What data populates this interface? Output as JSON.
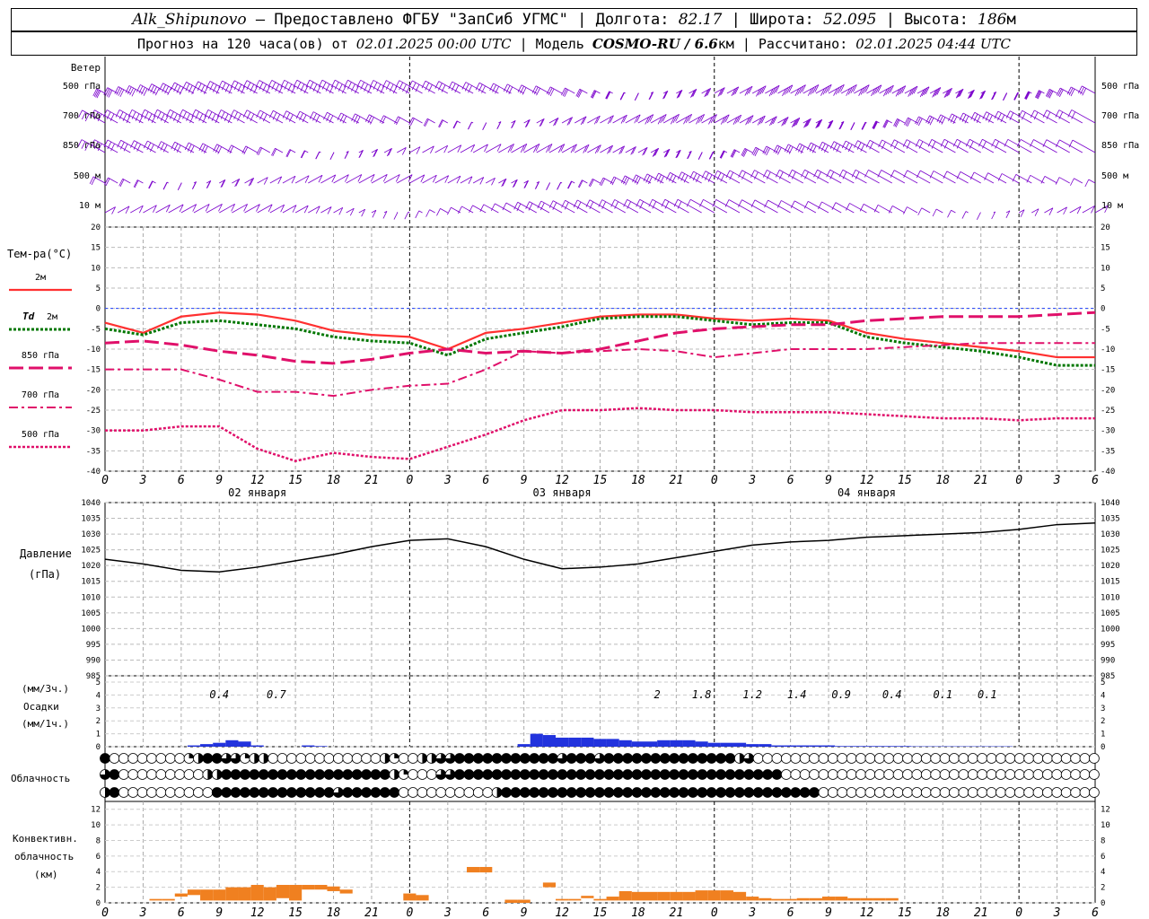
{
  "header": {
    "station": "Alk_Shipunovo",
    "provider": " – Предоставлено ФГБУ \"ЗапСиб УГМС\" | ",
    "lon_label": "Долгота: ",
    "lon": "82.17",
    "lat_label": " | Широта: ",
    "lat": "52.095",
    "alt_label": " | Высота: ",
    "alt": "186",
    "alt_unit": "м"
  },
  "subheader": {
    "forecast_label": "Прогноз на 120 часа(ов) от ",
    "start": "02.01.2025 00:00 UTC",
    "model_label": " | Модель ",
    "model": "COSMO-RU / 6.6",
    "model_unit": "км",
    "calc_label": " | Рассчитано: ",
    "calc": "02.01.2025 04:44 UTC"
  },
  "colors": {
    "t2m": "#ff3030",
    "td2m": "#007700",
    "p850": "#e0106a",
    "p700": "#e0106a",
    "p500": "#e0106a",
    "wind": "#7a00cc",
    "precip": "#2233dd",
    "conv": "#f08020",
    "zero_line": "#2040ff"
  },
  "hour_ticks": [
    "0",
    "3",
    "6",
    "9",
    "12",
    "15",
    "18",
    "21",
    "0",
    "3",
    "6",
    "9",
    "12",
    "15",
    "18",
    "21",
    "0",
    "3",
    "6",
    "9",
    "12",
    "15",
    "18",
    "21",
    "0",
    "3",
    "6"
  ],
  "day_labels": [
    "02 января",
    "03 января",
    "04 января"
  ],
  "wind_panel": {
    "title": "Ветер",
    "levels": [
      "500 гПа",
      "700 гПа",
      "850 гПа",
      "500 м",
      "10 м"
    ],
    "levels_right": [
      "500 гПа",
      "700 гПа",
      "850 гПа",
      "500 м",
      "10 м"
    ]
  },
  "temp_panel": {
    "title": "Тем-ра(°С)",
    "legend": [
      {
        "key": "t2m",
        "label": "2м",
        "style": "solid"
      },
      {
        "key": "td2m",
        "label": "2м",
        "prefix": "Td",
        "style": "dotted"
      },
      {
        "key": "p850",
        "label": "850 гПа",
        "style": "dash"
      },
      {
        "key": "p700",
        "label": "700 гПа",
        "style": "dashdot"
      },
      {
        "key": "p500",
        "label": "500 гПа",
        "style": "dot"
      }
    ],
    "yticks": [
      "20",
      "15",
      "10",
      "5",
      "0",
      "-5",
      "-10",
      "-15",
      "-20",
      "-25",
      "-30",
      "-35",
      "-40"
    ]
  },
  "pressure_panel": {
    "title1": "Давление",
    "title2": "(гПа)",
    "yticks": [
      "1040",
      "1035",
      "1030",
      "1025",
      "1020",
      "1015",
      "1010",
      "1005",
      "1000",
      "995",
      "990",
      "985"
    ]
  },
  "precip_panel": {
    "title1": "(мм/3ч.)",
    "title2": "Осадки",
    "title3": "(мм/1ч.)",
    "yticks": [
      "5",
      "4",
      "3",
      "2",
      "1",
      "0"
    ],
    "sums": [
      {
        "h": 9,
        "v": "0.4"
      },
      {
        "h": 13.5,
        "v": "0.7"
      },
      {
        "h": 43.5,
        "v": "2"
      },
      {
        "h": 47,
        "v": "1.8"
      },
      {
        "h": 51,
        "v": "1.2"
      },
      {
        "h": 54.5,
        "v": "1.4"
      },
      {
        "h": 58,
        "v": "0.9"
      },
      {
        "h": 62,
        "v": "0.4"
      },
      {
        "h": 66,
        "v": "0.1"
      },
      {
        "h": 69.5,
        "v": "0.1"
      }
    ]
  },
  "cloud_panel": {
    "title": "Облачность"
  },
  "conv_panel": {
    "title1": "Конвективн.",
    "title2": "облачность",
    "title3": "(км)",
    "yticks": [
      "12",
      "10",
      "8",
      "6",
      "4",
      "2",
      "0"
    ]
  },
  "chart_data": [
    {
      "type": "line",
      "name": "temperature",
      "x_hours": [
        0,
        3,
        6,
        9,
        12,
        15,
        18,
        21,
        24,
        27,
        30,
        33,
        36,
        39,
        42,
        45,
        48,
        51,
        54,
        57,
        60,
        63,
        66,
        69,
        72,
        75,
        78
      ],
      "ylim": [
        -40,
        20
      ],
      "series": [
        {
          "key": "t2m",
          "values": [
            -3.5,
            -6,
            -2,
            -1,
            -1.5,
            -3,
            -5.5,
            -6.5,
            -7,
            -10,
            -6,
            -5,
            -3.5,
            -2,
            -1.5,
            -1.5,
            -2.5,
            -3,
            -2.5,
            -3,
            -6,
            -7.5,
            -8.5,
            -9.5,
            -10.5,
            -12,
            -12
          ]
        },
        {
          "key": "td2m",
          "values": [
            -5,
            -6.5,
            -3.5,
            -3,
            -4,
            -5,
            -7,
            -8,
            -8.5,
            -11.5,
            -7.5,
            -6,
            -4.5,
            -2.5,
            -2,
            -2,
            -3,
            -4,
            -3.5,
            -3.5,
            -7,
            -8.5,
            -9.5,
            -10.5,
            -12,
            -14,
            -14
          ]
        },
        {
          "key": "p850",
          "values": [
            -8.5,
            -8,
            -9,
            -10.5,
            -11.5,
            -13,
            -13.5,
            -12.5,
            -11,
            -10,
            -11,
            -10.5,
            -11,
            -10,
            -8,
            -6,
            -5,
            -4.5,
            -4,
            -4,
            -3,
            -2.5,
            -2,
            -2,
            -2,
            -1.5,
            -1
          ]
        },
        {
          "key": "p700",
          "values": [
            -15,
            -15,
            -15,
            -17.5,
            -20.5,
            -20.5,
            -21.5,
            -20,
            -19,
            -18.5,
            -15,
            -10.5,
            -11,
            -10.5,
            -10,
            -10.5,
            -12,
            -11,
            -10,
            -10,
            -10,
            -9.5,
            -9,
            -8.5,
            -8.5,
            -8.5,
            -8.5
          ]
        },
        {
          "key": "p500",
          "values": [
            -30,
            -30,
            -29,
            -29,
            -34.5,
            -37.5,
            -35.5,
            -36.5,
            -37,
            -34,
            -31,
            -27.5,
            -25,
            -25,
            -24.5,
            -25,
            -25,
            -25.5,
            -25.5,
            -25.5,
            -26,
            -26.5,
            -27,
            -27,
            -27.5,
            -27,
            -27
          ]
        }
      ]
    },
    {
      "type": "line",
      "name": "pressure",
      "x_hours": [
        0,
        3,
        6,
        9,
        12,
        15,
        18,
        21,
        24,
        27,
        30,
        33,
        36,
        39,
        42,
        45,
        48,
        51,
        54,
        57,
        60,
        63,
        66,
        69,
        72,
        75,
        78
      ],
      "ylim": [
        985,
        1040
      ],
      "values": [
        1022,
        1020.5,
        1018.5,
        1018,
        1019.5,
        1021.5,
        1023.5,
        1026,
        1028,
        1028.5,
        1026,
        1022,
        1019,
        1019.5,
        1020.5,
        1022.5,
        1024.5,
        1026.5,
        1027.5,
        1028,
        1029,
        1029.5,
        1030,
        1030.5,
        1031.5,
        1033,
        1033.5
      ]
    },
    {
      "type": "bar",
      "name": "precipitation_mm_per_1h",
      "ylim": [
        0,
        5
      ],
      "x_hours": [
        7,
        8,
        9,
        10,
        11,
        12,
        16,
        17,
        33,
        34,
        35,
        36,
        37,
        38,
        39,
        40,
        41,
        42,
        43,
        44,
        45,
        46,
        47,
        48,
        49,
        50,
        51,
        52,
        53,
        54,
        55,
        56,
        57,
        58,
        59,
        60,
        61,
        62,
        63,
        64,
        65,
        66,
        67,
        68,
        69,
        70,
        71
      ],
      "values": [
        0.1,
        0.2,
        0.3,
        0.5,
        0.4,
        0.1,
        0.1,
        0.05,
        0.2,
        1.0,
        0.9,
        0.7,
        0.7,
        0.7,
        0.6,
        0.6,
        0.5,
        0.4,
        0.4,
        0.5,
        0.5,
        0.5,
        0.4,
        0.3,
        0.3,
        0.3,
        0.2,
        0.2,
        0.1,
        0.1,
        0.1,
        0.1,
        0.1,
        0.05,
        0.05,
        0.05,
        0.05,
        0.05,
        0.05,
        0.03,
        0.03,
        0.03,
        0.03,
        0.03,
        0.03,
        0.03,
        0.03
      ]
    },
    {
      "type": "bar",
      "name": "convective_cloud_km",
      "ylim": [
        0,
        13
      ],
      "x_hours": [
        4,
        5,
        6,
        7,
        8,
        9,
        10,
        11,
        12,
        13,
        14,
        15,
        16,
        17,
        18,
        19,
        20,
        24,
        25,
        29,
        30,
        32,
        33,
        35,
        36,
        37,
        38,
        39,
        40,
        41,
        42,
        43,
        44,
        45,
        46,
        47,
        48,
        49,
        50,
        51,
        52,
        53,
        54,
        55,
        56,
        57,
        58,
        59,
        60,
        61,
        62
      ],
      "bottoms": [
        0.3,
        0.3,
        0.8,
        1.0,
        0.3,
        0.3,
        0.3,
        0.3,
        0.3,
        0.3,
        0.6,
        0.3,
        1.7,
        1.7,
        1.5,
        1.2,
        0,
        0.3,
        0.3,
        3.9,
        3.9,
        0,
        0,
        2.0,
        0.3,
        0.3,
        0.6,
        0.3,
        0.3,
        0.3,
        0.3,
        0.3,
        0.3,
        0.3,
        0.3,
        0.3,
        0.3,
        0.3,
        0.3,
        0.3,
        0.3,
        0.3,
        0.3,
        0.3,
        0.3,
        0.3,
        0.3,
        0.3,
        0.3,
        0.3,
        0.3
      ],
      "tops": [
        0.5,
        0.5,
        1.2,
        1.7,
        1.7,
        1.7,
        2.0,
        2.0,
        2.3,
        2.0,
        2.3,
        2.3,
        2.3,
        2.3,
        2.1,
        1.7,
        0,
        1.2,
        1.0,
        4.6,
        4.6,
        0.4,
        0.4,
        2.6,
        0.5,
        0.5,
        0.9,
        0.5,
        0.8,
        1.5,
        1.4,
        1.4,
        1.4,
        1.4,
        1.4,
        1.6,
        1.6,
        1.6,
        1.4,
        0.8,
        0.6,
        0.5,
        0.5,
        0.6,
        0.6,
        0.8,
        0.8,
        0.6,
        0.6,
        0.6,
        0.6
      ]
    },
    {
      "type": "table",
      "name": "cloud_cover_symbols",
      "legend": "0=clear,1=quarter,2=half,3=three-quarters,4=overcast",
      "rows": [
        "40000000012443312200000000000021002233444444444443444344444444444444230000000000000000000000000000000000000",
        "34000000000224444444444444444442100033444444444444444444444444444444444440000000000000000000000000000000000",
        "24000000000044444444444443444444000000000024444444444444444444444444444444444000000000000000000000000000000"
      ]
    }
  ]
}
